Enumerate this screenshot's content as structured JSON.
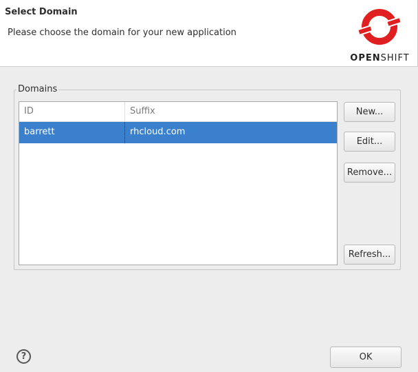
{
  "header": {
    "title": "Select Domain",
    "subtitle": "Please choose the domain for your new application",
    "logo_text_bold": "OPEN",
    "logo_text_light": "SHIFT"
  },
  "group": {
    "label": "Domains"
  },
  "table": {
    "columns": [
      "ID",
      "Suffix"
    ],
    "rows": [
      {
        "id": "barrett",
        "suffix": "rhcloud.com",
        "selected": true
      }
    ]
  },
  "buttons": {
    "new": "New...",
    "edit": "Edit...",
    "remove": "Remove...",
    "refresh": "Refresh...",
    "ok": "OK"
  },
  "help": {
    "glyph": "?"
  },
  "colors": {
    "selection": "#3a80cc",
    "logo_red": "#e02020"
  }
}
